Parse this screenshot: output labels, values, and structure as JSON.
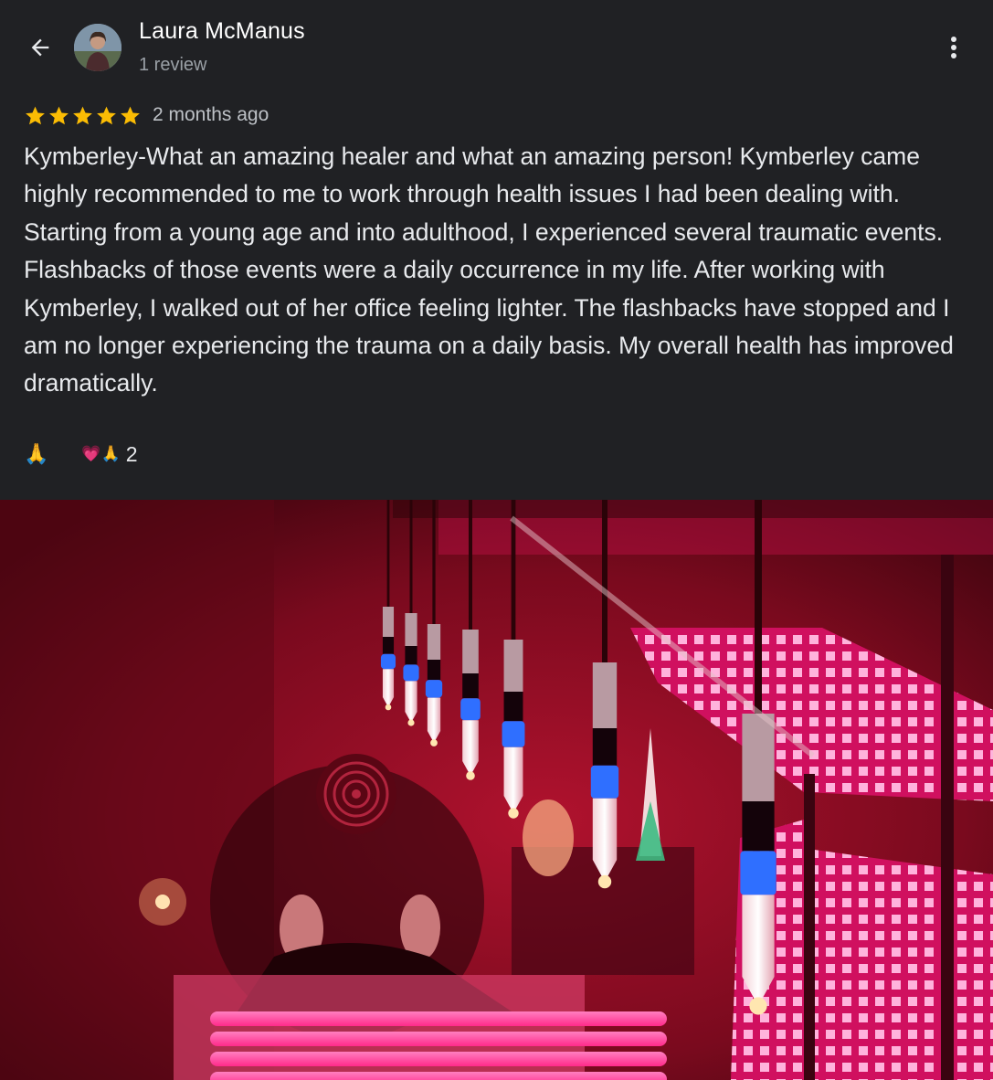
{
  "header": {
    "reviewer_name": "Laura McManus",
    "review_count": "1 review",
    "back_icon": "arrow-left-icon",
    "more_icon": "more-vert-icon"
  },
  "review": {
    "rating": 5,
    "max_rating": 5,
    "time_ago": "2 months ago",
    "text": "Kymberley-What an amazing healer and what an amazing person! Kymberley came highly recommended to me to work through health issues I had been dealing with. Starting from a young age and into adulthood, I experienced several traumatic events. Flashbacks of those events were a daily occurrence in my life. After working with Kymberley, I walked out of her office feeling lighter. The flashbacks have stopped and I am no longer experiencing the trauma on a daily basis. My overall health has improved dramatically."
  },
  "reactions": {
    "react_button": "🙏",
    "summary_emojis": "💗🙏",
    "count": "2"
  },
  "colors": {
    "background": "#202124",
    "star": "#fbbc04",
    "text": "#e8eaed",
    "secondary_text": "#9aa0a6"
  }
}
